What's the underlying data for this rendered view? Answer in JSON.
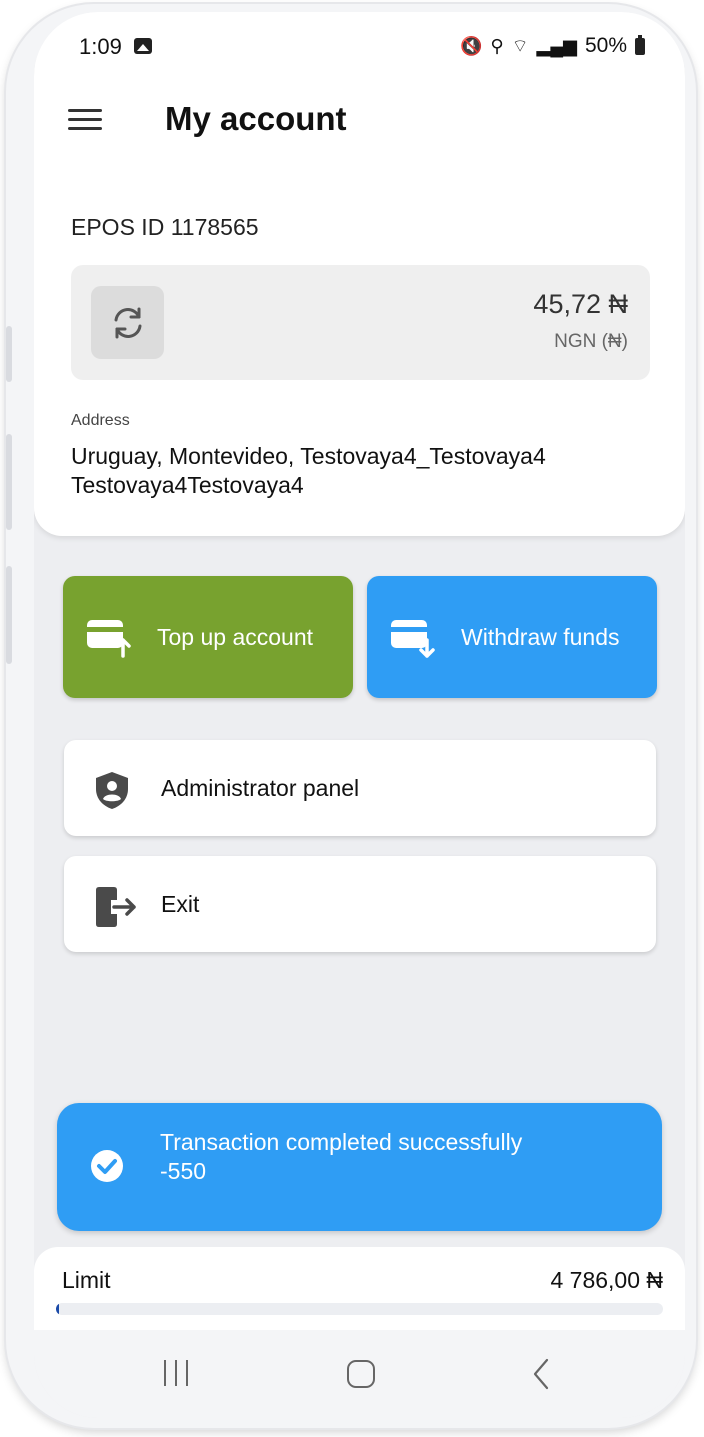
{
  "status_bar": {
    "time": "1:09",
    "battery": "50%"
  },
  "header": {
    "title": "My account"
  },
  "account": {
    "epos_id": "EPOS ID 1178565",
    "balance": "45,72 ₦",
    "currency": "NGN (₦)",
    "address_label": "Address",
    "address": "Uruguay, Montevideo, Testovaya4_Testovaya4 Testovaya4Testovaya4"
  },
  "actions": {
    "top_up": "Top up account",
    "withdraw": "Withdraw funds"
  },
  "menu": {
    "admin": "Administrator panel",
    "exit": "Exit"
  },
  "toast": {
    "message": "Transaction completed successfully",
    "amount": "-550"
  },
  "limit": {
    "label": "Limit",
    "value": "4 786,00 ₦",
    "progress": 0.005
  },
  "colors": {
    "green": "#78a22f",
    "blue": "#2f9df4",
    "limit_bar": "#1a4aa8"
  }
}
